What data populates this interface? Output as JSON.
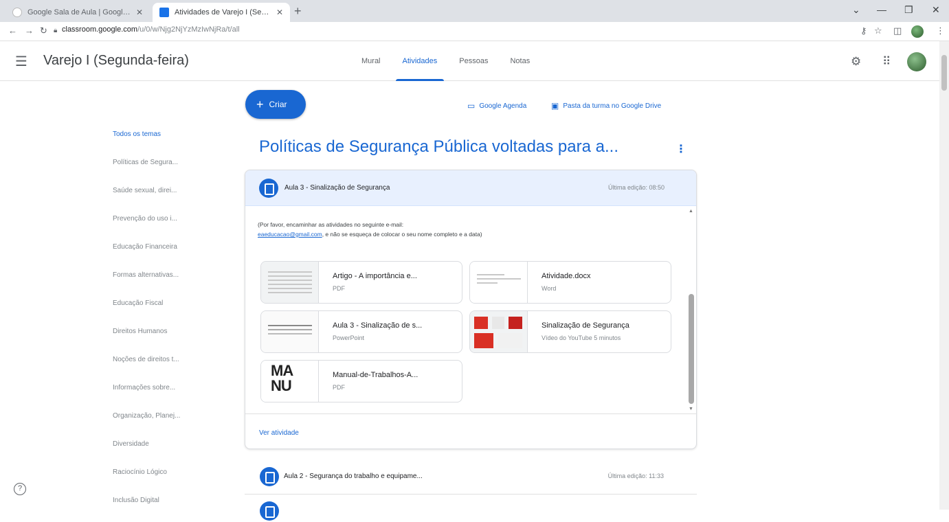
{
  "browser": {
    "tabs": [
      {
        "title": "Google Sala de Aula | Google fo...",
        "active": false
      },
      {
        "title": "Atividades de Varejo I (Segunda-...",
        "active": true
      }
    ],
    "url_domain": "classroom.google.com",
    "url_path": "/u/0/w/Njg2NjYzMzIwNjRa/t/all"
  },
  "header": {
    "class_name": "Varejo I (Segunda-feira)",
    "tabs": [
      "Mural",
      "Atividades",
      "Pessoas",
      "Notas"
    ],
    "active_tab": "Atividades"
  },
  "sidebar": {
    "topics": [
      "Todos os temas",
      "Políticas de Segura...",
      "Saúde sexual, direi...",
      "Prevenção do uso i...",
      "Educação Financeira",
      "Formas alternativas...",
      "Educação Fiscal",
      "Direitos Humanos",
      "Noções de direitos t...",
      "Informações sobre...",
      "Organização, Planej...",
      "Diversidade",
      "Raciocínio Lógico",
      "Inclusão Digital"
    ],
    "active_index": 0
  },
  "actions": {
    "create_label": "Criar",
    "calendar_link": "Google Agenda",
    "drive_link": "Pasta da turma no Google Drive"
  },
  "topic": {
    "title": "Políticas de Segurança Pública voltadas para a..."
  },
  "expanded_card": {
    "title": "Aula 3 - Sinalização de Segurança",
    "edited": "Última edição: 08:50",
    "description_1": "(Por favor, encaminhar as atividades no seguinte e-mail:",
    "email": "eaeducacao@gmail.com",
    "description_2": ", e não se esqueça de colocar o seu nome completo e a data)",
    "materials": [
      {
        "name": "Artigo - A importância e...",
        "type": "PDF"
      },
      {
        "name": "Atividade.docx",
        "type": "Word"
      },
      {
        "name": "Aula 3 - Sinalização de s...",
        "type": "PowerPoint"
      },
      {
        "name": "Sinalização de Segurança",
        "type": "Vídeo do YouTube  5 minutos"
      },
      {
        "name": "Manual-de-Trabalhos-A...",
        "type": "PDF"
      }
    ],
    "view_label": "Ver atividade"
  },
  "collapsed_card": {
    "title": "Aula 2 - Segurança do trabalho e equipame...",
    "edited": "Última edição: 11:33"
  }
}
